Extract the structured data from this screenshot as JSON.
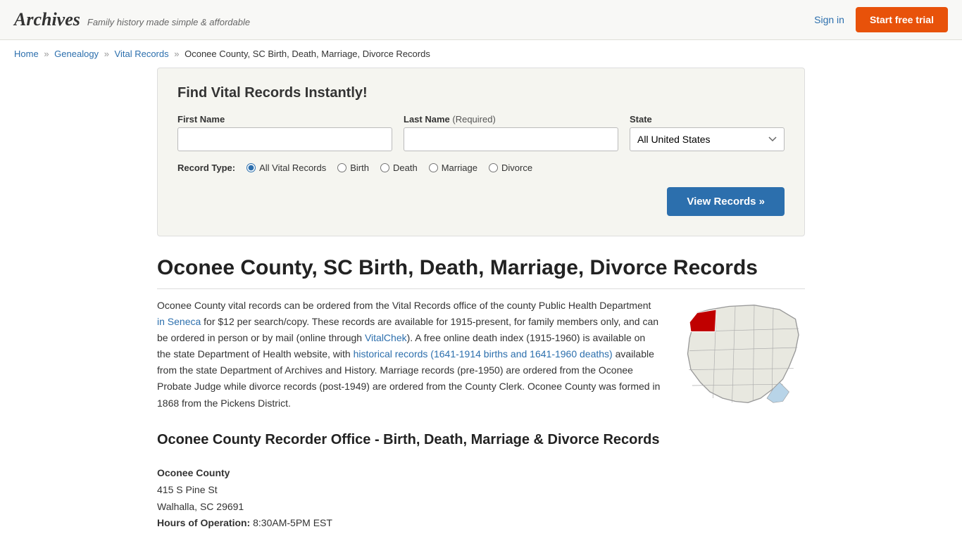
{
  "header": {
    "logo_text": "Archives",
    "tagline": "Family history made simple & affordable",
    "signin_label": "Sign in",
    "free_trial_label": "Start free trial"
  },
  "breadcrumb": {
    "home": "Home",
    "genealogy": "Genealogy",
    "vital_records": "Vital Records",
    "current": "Oconee County, SC Birth, Death, Marriage, Divorce Records"
  },
  "search": {
    "title": "Find Vital Records Instantly!",
    "first_name_label": "First Name",
    "last_name_label": "Last Name",
    "last_name_required": "(Required)",
    "state_label": "State",
    "state_default": "All United States",
    "record_type_label": "Record Type:",
    "record_types": [
      "All Vital Records",
      "Birth",
      "Death",
      "Marriage",
      "Divorce"
    ],
    "view_records_label": "View Records »",
    "first_name_placeholder": "",
    "last_name_placeholder": ""
  },
  "page": {
    "title": "Oconee County, SC Birth, Death, Marriage, Divorce Records",
    "article_text": "Oconee County vital records can be ordered from the Vital Records office of the county Public Health Department in Seneca for $12 per search/copy. These records are available for 1915-present, for family members only, and can be ordered in person or by mail (online through VitalChek). A free online death index (1915-1960) is available on the state Department of Health website, with historical records (1641-1914 births and 1641-1960 deaths) available from the state Department of Archives and History. Marriage records (pre-1950) are ordered from the Oconee Probate Judge while divorce records (post-1949) are ordered from the County Clerk. Oconee County was formed in 1868 from the Pickens District.",
    "section_heading": "Oconee County Recorder Office - Birth, Death, Marriage & Divorce Records",
    "office_name": "Oconee County",
    "office_address1": "415 S Pine St",
    "office_address2": "Walhalla, SC 29691",
    "hours_label": "Hours of Operation:",
    "hours_value": "8:30AM-5PM EST"
  },
  "colors": {
    "link": "#2c6fad",
    "orange": "#e8520a",
    "blue_btn": "#2c6fad",
    "highlight_red": "#c00000"
  }
}
